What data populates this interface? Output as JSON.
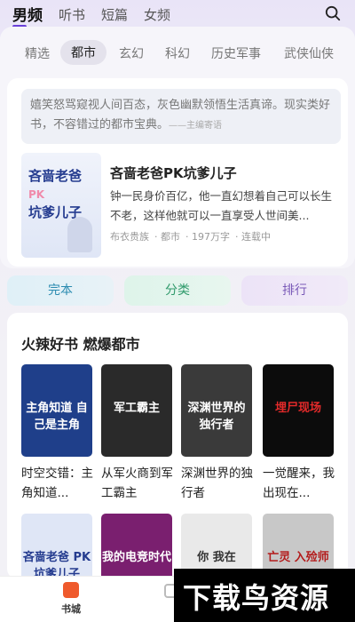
{
  "top_tabs": [
    {
      "label": "男频"
    },
    {
      "label": "听书"
    },
    {
      "label": "短篇"
    },
    {
      "label": "女频"
    }
  ],
  "categories": [
    "精选",
    "都市",
    "玄幻",
    "科幻",
    "历史军事",
    "武侠仙侠"
  ],
  "featured": {
    "quote": "嬉笑怒骂窥视人间百态，灰色幽默领悟生活真谛。现实类好书，不容错过的都市宝典。",
    "quote_source": "——主编寄语",
    "cover_text_top": "吝啬老爸",
    "cover_text_pk": "PK",
    "cover_text_bottom": "坑爹儿子",
    "title": "吝啬老爸PK坑爹儿子",
    "desc": "钟一民身价百亿，他一直幻想着自己可以长生不老，这样他就可以一直享受人世间美...",
    "author": "布衣贵族",
    "genre": "都市",
    "words": "197万字",
    "status": "连载中"
  },
  "quick_buttons": [
    "完本",
    "分类",
    "排行"
  ],
  "hot_section": {
    "title": "火辣好书 燃爆都市",
    "row1": [
      {
        "name": "时空交错：主角知道...",
        "cover": "主角知道 自己是主角",
        "color": "#1f3f8a"
      },
      {
        "name": "从军火商到军工霸主",
        "cover": "军工霸主",
        "color": "#2a2a2a"
      },
      {
        "name": "深渊世界的独行者",
        "cover": "深渊世界的 独行者",
        "color": "#3a3a3a"
      },
      {
        "name": "一觉醒来，我出现在...",
        "cover": "埋尸现场",
        "color": "#0c0c0c"
      }
    ],
    "row2": [
      {
        "cover": "吝啬老爸 PK 坑爹儿子",
        "color": "#dfe6f6"
      },
      {
        "cover": "我的电竞时代",
        "color": "#7a1f6f"
      },
      {
        "cover": "你 我在",
        "color": "#e9e9e9"
      },
      {
        "cover": "亡灵 入殓师",
        "color": "#c8c8c8"
      }
    ]
  },
  "bottom_nav": [
    {
      "label": "书城"
    }
  ],
  "watermark": "下载鸟资源"
}
